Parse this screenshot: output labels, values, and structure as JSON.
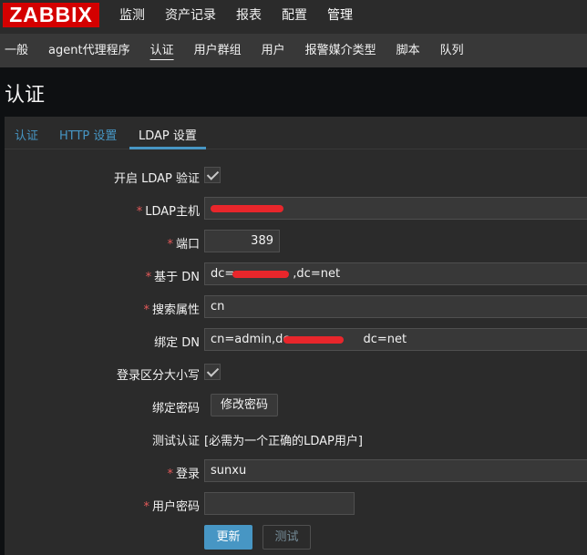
{
  "brand": {
    "logo": "ZABBIX",
    "logo_color": "#d40000"
  },
  "top_menu": [
    "监测",
    "资产记录",
    "报表",
    "配置",
    "管理"
  ],
  "sub_menu": [
    "一般",
    "agent代理程序",
    "认证",
    "用户群组",
    "用户",
    "报警媒介类型",
    "脚本",
    "队列"
  ],
  "page_title": "认证",
  "tabs": [
    "认证",
    "HTTP 设置",
    "LDAP 设置"
  ],
  "form": {
    "enable_ldap_label": "开启 LDAP 验证",
    "host_label": "LDAP主机",
    "host_value": "",
    "port_label": "端口",
    "port_value": "389",
    "base_dn_label": "基于 DN",
    "base_dn_prefix": "dc=",
    "base_dn_suffix": ",dc=net",
    "search_attr_label": "搜索属性",
    "search_attr_value": "cn",
    "bind_dn_label": "绑定 DN",
    "bind_dn_prefix": "cn=admin,dc=",
    "bind_dn_suffix": "dc=net",
    "case_label": "登录区分大小写",
    "bind_pwd_label": "绑定密码",
    "change_pwd_button": "修改密码",
    "test_auth_label": "测试认证",
    "test_auth_hint": "[必需为一个正确的LDAP用户]",
    "login_label": "登录",
    "login_value": "sunxu",
    "user_pwd_label": "用户密码",
    "user_pwd_value": "",
    "update_button": "更新",
    "test_button": "测试",
    "required_mark": "*"
  },
  "colors": {
    "accent": "#4796c4",
    "required": "#e45959",
    "redaction": "#e8262b"
  }
}
